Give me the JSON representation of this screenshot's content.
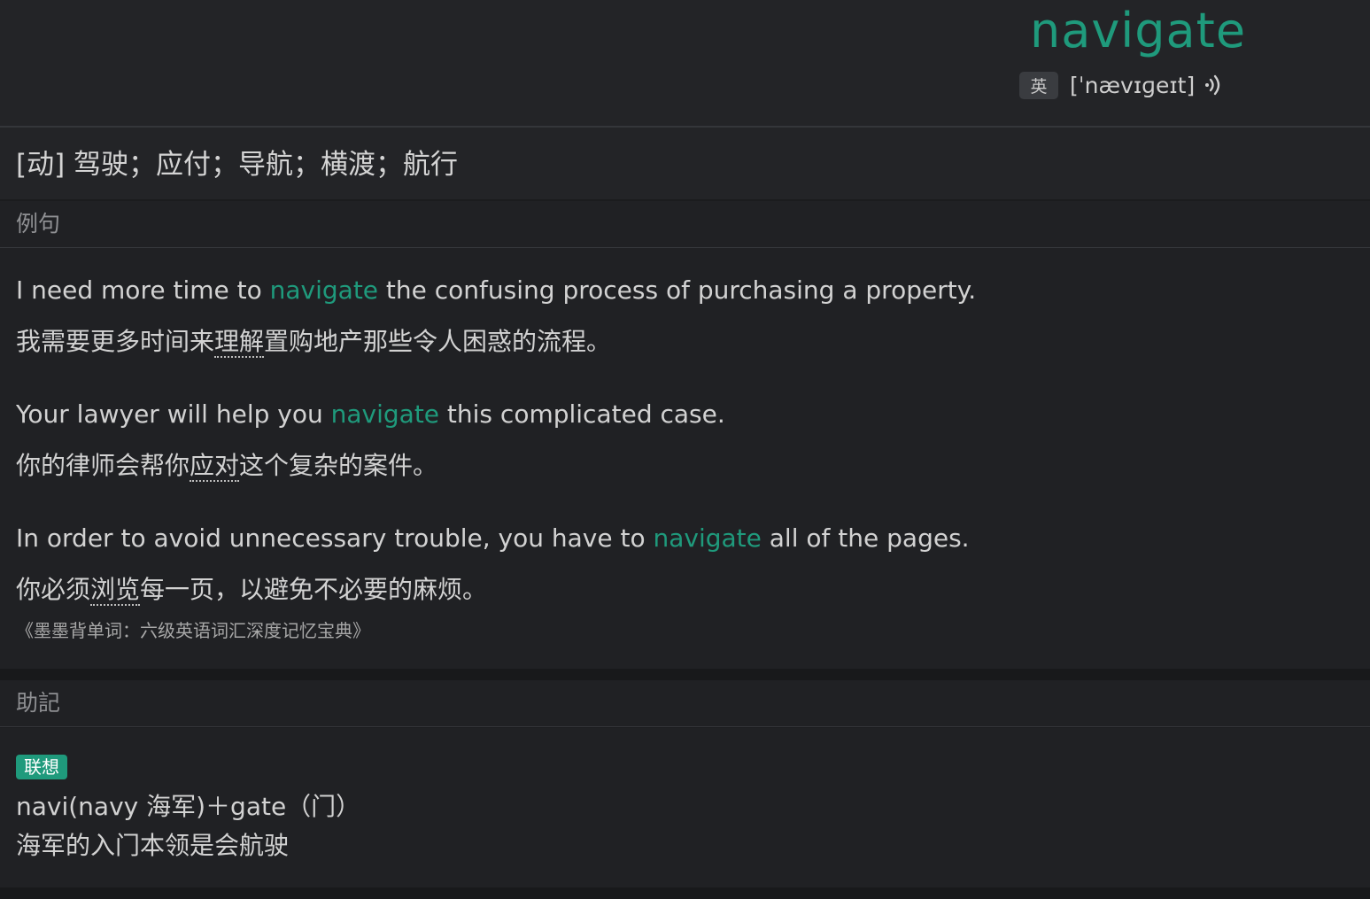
{
  "header": {
    "word": "navigate",
    "accent_label": "英",
    "phonetic": "[ˈnævɪɡeɪt]",
    "speaker_icon": "speaker-icon"
  },
  "definition": {
    "text": "[动] 驾驶；应付；导航；横渡；航行"
  },
  "examples_section": {
    "title": "例句",
    "items": [
      {
        "en_before": "I need more time to ",
        "en_keyword": "navigate",
        "en_after": " the confusing process of purchasing a property.",
        "zh_before": "我需要更多时间来",
        "zh_keyword": "理解",
        "zh_after": "置购地产那些令人困惑的流程。"
      },
      {
        "en_before": "Your lawyer will help you ",
        "en_keyword": "navigate",
        "en_after": " this complicated case.",
        "zh_before": "你的律师会帮你",
        "zh_keyword": "应对",
        "zh_after": "这个复杂的案件。"
      },
      {
        "en_before": "In order to avoid unnecessary trouble, you have to ",
        "en_keyword": "navigate",
        "en_after": " all of the pages.",
        "zh_before": "你必须",
        "zh_keyword": "浏览",
        "zh_after": "每一页，以避免不必要的麻烦。"
      }
    ],
    "source": "《墨墨背单词：六级英语词汇深度记忆宝典》"
  },
  "mnemonic_section": {
    "title": "助記",
    "badge": "联想",
    "line1": "navi(navy  海军)＋gate（门）",
    "line2": "海军的入门本领是会航驶"
  },
  "colors": {
    "accent": "#1f9a7c",
    "background": "#1b1c1e",
    "panel": "#232427"
  }
}
